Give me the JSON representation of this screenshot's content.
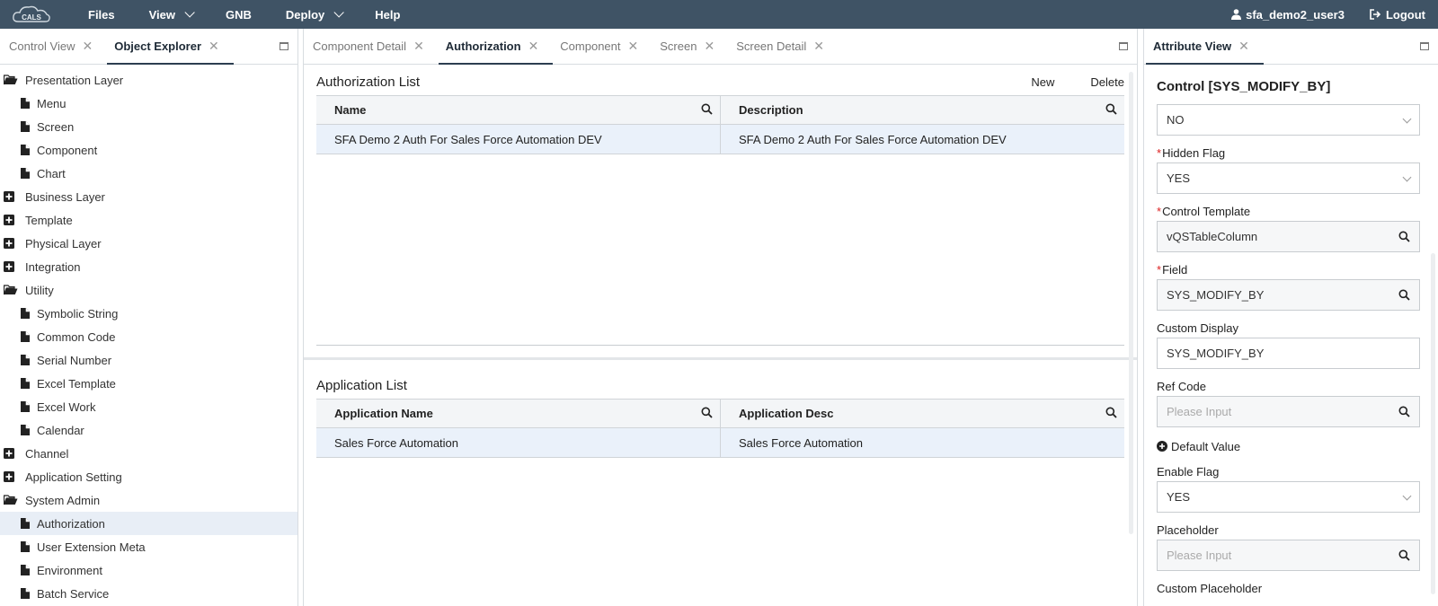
{
  "topbar": {
    "logo_text": "CALS",
    "nav": [
      {
        "label": "Files",
        "has_dropdown": false
      },
      {
        "label": "View",
        "has_dropdown": true
      },
      {
        "label": "GNB",
        "has_dropdown": false
      },
      {
        "label": "Deploy",
        "has_dropdown": true
      },
      {
        "label": "Help",
        "has_dropdown": false
      }
    ],
    "user": "sfa_demo2_user3",
    "logout": "Logout",
    "colors": {
      "background": "#3f5365",
      "text": "#ffffff"
    }
  },
  "left_panel": {
    "tabs": [
      {
        "label": "Control View",
        "active": false
      },
      {
        "label": "Object Explorer",
        "active": true
      }
    ],
    "tree": [
      {
        "label": "Presentation Layer",
        "level": 0,
        "icon": "folder-open-icon"
      },
      {
        "label": "Menu",
        "level": 1,
        "icon": "file-icon"
      },
      {
        "label": "Screen",
        "level": 1,
        "icon": "file-icon"
      },
      {
        "label": "Component",
        "level": 1,
        "icon": "file-icon"
      },
      {
        "label": "Chart",
        "level": 1,
        "icon": "file-icon"
      },
      {
        "label": "Business Layer",
        "level": 0,
        "icon": "plus-box-icon"
      },
      {
        "label": "Template",
        "level": 0,
        "icon": "plus-box-icon"
      },
      {
        "label": "Physical Layer",
        "level": 0,
        "icon": "plus-box-icon"
      },
      {
        "label": "Integration",
        "level": 0,
        "icon": "plus-box-icon"
      },
      {
        "label": "Utility",
        "level": 0,
        "icon": "folder-open-icon"
      },
      {
        "label": "Symbolic String",
        "level": 1,
        "icon": "file-icon"
      },
      {
        "label": "Common Code",
        "level": 1,
        "icon": "file-icon"
      },
      {
        "label": "Serial Number",
        "level": 1,
        "icon": "file-icon"
      },
      {
        "label": "Excel Template",
        "level": 1,
        "icon": "file-icon"
      },
      {
        "label": "Excel Work",
        "level": 1,
        "icon": "file-icon"
      },
      {
        "label": "Calendar",
        "level": 1,
        "icon": "file-icon"
      },
      {
        "label": "Channel",
        "level": 0,
        "icon": "plus-box-icon"
      },
      {
        "label": "Application Setting",
        "level": 0,
        "icon": "plus-box-icon"
      },
      {
        "label": "System Admin",
        "level": 0,
        "icon": "folder-open-icon"
      },
      {
        "label": "Authorization",
        "level": 1,
        "icon": "file-icon",
        "selected": true
      },
      {
        "label": "User Extension Meta",
        "level": 1,
        "icon": "file-icon"
      },
      {
        "label": "Environment",
        "level": 1,
        "icon": "file-icon"
      },
      {
        "label": "Batch Service",
        "level": 1,
        "icon": "file-icon"
      }
    ]
  },
  "center_panel": {
    "tabs": [
      {
        "label": "Component Detail",
        "active": false
      },
      {
        "label": "Authorization",
        "active": true
      },
      {
        "label": "Component",
        "active": false
      },
      {
        "label": "Screen",
        "active": false
      },
      {
        "label": "Screen Detail",
        "active": false
      }
    ],
    "authorization_list": {
      "title": "Authorization List",
      "actions": [
        "New",
        "Delete"
      ],
      "columns": [
        "Name",
        "Description"
      ],
      "rows": [
        [
          "SFA Demo 2 Auth For Sales Force Automation DEV",
          "SFA Demo 2 Auth For Sales Force Automation DEV"
        ]
      ]
    },
    "application_list": {
      "title": "Application List",
      "columns": [
        "Application Name",
        "Application Desc"
      ],
      "rows": [
        [
          "Sales Force Automation",
          "Sales Force Automation"
        ]
      ]
    },
    "colors": {
      "selected_row": "#eaf1fa",
      "header_bg": "#f3f5f7"
    }
  },
  "right_panel": {
    "tabs": [
      {
        "label": "Attribute View",
        "active": true
      }
    ],
    "title": "Control [SYS_MODIFY_BY]",
    "top_field": {
      "value": "NO",
      "type": "dropdown"
    },
    "fields": [
      {
        "label": "Hidden Flag",
        "required": true,
        "value": "YES",
        "placeholder": "",
        "type": "dropdown",
        "readonly": false
      },
      {
        "label": "Control Template",
        "required": true,
        "value": "vQSTableColumn",
        "placeholder": "",
        "type": "search",
        "readonly": true
      },
      {
        "label": "Field",
        "required": true,
        "value": "SYS_MODIFY_BY",
        "placeholder": "",
        "type": "search",
        "readonly": true
      },
      {
        "label": "Custom Display",
        "required": false,
        "value": "SYS_MODIFY_BY",
        "placeholder": "",
        "type": "text",
        "readonly": false
      },
      {
        "label": "Ref Code",
        "required": false,
        "value": "",
        "placeholder": "Please Input",
        "type": "search",
        "readonly": true
      }
    ],
    "default_value_label": "Default Value",
    "fields2": [
      {
        "label": "Enable Flag",
        "required": false,
        "value": "YES",
        "placeholder": "",
        "type": "dropdown",
        "readonly": false
      },
      {
        "label": "Placeholder",
        "required": false,
        "value": "",
        "placeholder": "Please Input",
        "type": "search",
        "readonly": true
      }
    ],
    "last_label": "Custom Placeholder"
  }
}
